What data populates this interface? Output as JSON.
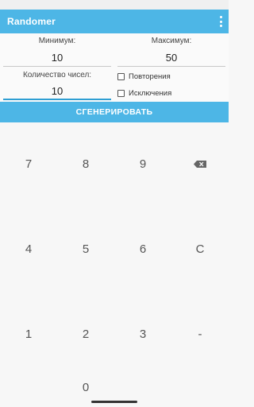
{
  "app": {
    "title": "Randomer"
  },
  "form": {
    "min_label": "Минимум:",
    "min_value": "10",
    "max_label": "Максимум:",
    "max_value": "50",
    "count_label": "Количество чисел:",
    "count_value": "10",
    "repeats_label": "Повторения",
    "exclusions_label": "Исключения"
  },
  "generate_label": "СГЕНЕРИРОВАТЬ",
  "keypad": {
    "k7": "7",
    "k8": "8",
    "k9": "9",
    "k4": "4",
    "k5": "5",
    "k6": "6",
    "clear": "C",
    "k1": "1",
    "k2": "2",
    "k3": "3",
    "minus": "-",
    "k0": "0",
    "backspace_icon": "backspace-icon"
  },
  "colors": {
    "accent": "#4db6e6",
    "active_underline": "#2f9fd3"
  }
}
